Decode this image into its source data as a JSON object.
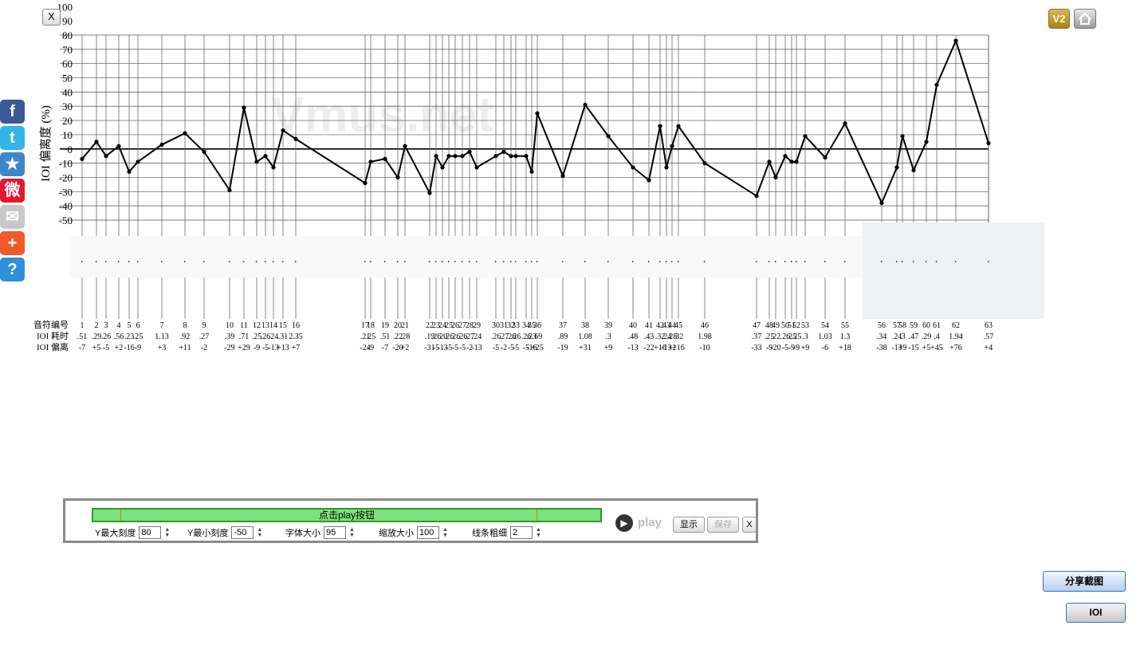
{
  "close_label": "X",
  "social": [
    {
      "icon": "facebook-icon",
      "glyph": "f",
      "color": "#3b5998"
    },
    {
      "icon": "twitter-icon",
      "glyph": "t",
      "color": "#33b4e8"
    },
    {
      "icon": "favorite-star-icon",
      "glyph": "★",
      "color": "#3f86c9"
    },
    {
      "icon": "weibo-icon",
      "glyph": "微",
      "color": "#e6162d"
    },
    {
      "icon": "mail-icon",
      "glyph": "✉",
      "color": "#c8c8c8"
    },
    {
      "icon": "plus-share-icon",
      "glyph": "+",
      "color": "#f05a28"
    },
    {
      "icon": "help-icon",
      "glyph": "?",
      "color": "#2f8fd8"
    }
  ],
  "top_right": {
    "v2_label": "V2"
  },
  "watermark": "Vmus.net",
  "chart_data": {
    "type": "line",
    "ylabel": "IOI 偏离度 (%)",
    "y_ticks": [
      100,
      90,
      80,
      70,
      60,
      50,
      40,
      30,
      20,
      10,
      0,
      -10,
      -20,
      -30,
      -40,
      -50
    ],
    "ylim": [
      -50,
      80
    ],
    "grid": true,
    "row_labels": [
      "音符编号",
      "IOI 耗时",
      "IOI 偏离"
    ],
    "points": [
      {
        "n": "1",
        "t": ".51",
        "d": -7
      },
      {
        "n": "2",
        "t": ".29",
        "d": 5
      },
      {
        "n": "3",
        "t": ".26",
        "d": -5
      },
      {
        "n": "4",
        "t": ".56",
        "d": 2
      },
      {
        "n": "5",
        "t": ".23",
        "d": -16
      },
      {
        "n": "6",
        "t": ".25",
        "d": -9
      },
      {
        "n": "7",
        "t": "1.13",
        "d": 3
      },
      {
        "n": "8",
        "t": ".92",
        "d": 11
      },
      {
        "n": "9",
        "t": ".27",
        "d": -2
      },
      {
        "n": "10",
        "t": ".39",
        "d": -29
      },
      {
        "n": "11",
        "t": ".71",
        "d": 29
      },
      {
        "n": "12",
        "t": ".25",
        "d": -9
      },
      {
        "n": "13",
        "t": ".26",
        "d": -5
      },
      {
        "n": "14",
        "t": ".24",
        "d": -13
      },
      {
        "n": "15",
        "t": ".31",
        "d": 13
      },
      {
        "n": "16",
        "t": "2.35",
        "d": 7
      },
      {
        "n": "17",
        "t": ".21",
        "d": -24
      },
      {
        "n": "18",
        "t": ".25",
        "d": -9
      },
      {
        "n": "19",
        "t": ".51",
        "d": -7
      },
      {
        "n": "20",
        "t": ".22",
        "d": -20
      },
      {
        "n": "21",
        "t": ".28",
        "d": 2
      },
      {
        "n": "22",
        "t": ".19",
        "d": -31
      },
      {
        "n": "23",
        "t": ".26",
        "d": -5
      },
      {
        "n": "24",
        "t": ".20",
        "d": -13
      },
      {
        "n": "25",
        "t": ".26",
        "d": -5
      },
      {
        "n": "26",
        "t": ".26",
        "d": -5
      },
      {
        "n": "27",
        "t": ".26",
        "d": -5
      },
      {
        "n": "28",
        "t": ".27",
        "d": -2
      },
      {
        "n": "29",
        "t": ".24",
        "d": -13
      },
      {
        "n": "30",
        "t": ".26",
        "d": -5
      },
      {
        "n": "31",
        "t": ".27",
        "d": -2
      },
      {
        "n": "32",
        "t": ".26",
        "d": -5
      },
      {
        "n": "33",
        "t": ".26",
        "d": -5
      },
      {
        "n": "34",
        "t": ".26",
        "d": -5
      },
      {
        "n": "35",
        "t": ".23",
        "d": -16
      },
      {
        "n": "36",
        "t": ".69",
        "d": 25
      },
      {
        "n": "37",
        "t": ".89",
        "d": -19
      },
      {
        "n": "38",
        "t": "1.08",
        "d": 31
      },
      {
        "n": "39",
        "t": ".3",
        "d": 9
      },
      {
        "n": "40",
        "t": ".48",
        "d": -13
      },
      {
        "n": "41",
        "t": ".43",
        "d": -22
      },
      {
        "n": "42",
        "t": ".32",
        "d": 16
      },
      {
        "n": "43",
        "t": ".24",
        "d": -13
      },
      {
        "n": "44",
        "t": ".28",
        "d": 2
      },
      {
        "n": "45",
        "t": ".32",
        "d": 16
      },
      {
        "n": "46",
        "t": "1.98",
        "d": -10
      },
      {
        "n": "47",
        "t": ".37",
        "d": -33
      },
      {
        "n": "48",
        "t": ".25",
        "d": -9
      },
      {
        "n": "49",
        "t": ".22",
        "d": -20
      },
      {
        "n": "50",
        "t": ".26",
        "d": -5
      },
      {
        "n": "51",
        "t": ".25",
        "d": -9
      },
      {
        "n": "52",
        "t": ".25",
        "d": -9
      },
      {
        "n": "53",
        "t": ".3",
        "d": 9
      },
      {
        "n": "54",
        "t": "1.03",
        "d": -6
      },
      {
        "n": "55",
        "t": "1.3",
        "d": 18
      },
      {
        "n": "56",
        "t": ".34",
        "d": -38
      },
      {
        "n": "57",
        "t": ".24",
        "d": -13
      },
      {
        "n": "58",
        "t": ".3",
        "d": 9
      },
      {
        "n": "59",
        "t": ".47",
        "d": -15
      },
      {
        "n": "60",
        "t": ".29",
        "d": 5
      },
      {
        "n": "61",
        "t": ".4",
        "d": 45
      },
      {
        "n": "62",
        "t": "1.94",
        "d": 76
      },
      {
        "n": "63",
        "t": ".57",
        "d": 4
      }
    ]
  },
  "controls": {
    "progress_text": "点击play按钮",
    "play_label": "play",
    "show_label": "显示",
    "save_label": "保存",
    "close_label": "X",
    "fields": [
      {
        "label": "Y最大刻度",
        "value": "80"
      },
      {
        "label": "Y最小刻度",
        "value": "-50"
      },
      {
        "label": "字体大小",
        "value": "95"
      },
      {
        "label": "缩放大小",
        "value": "100"
      },
      {
        "label": "线条粗细",
        "value": "2"
      }
    ]
  },
  "share_label": "分享截图",
  "ioi_label": "IOI"
}
